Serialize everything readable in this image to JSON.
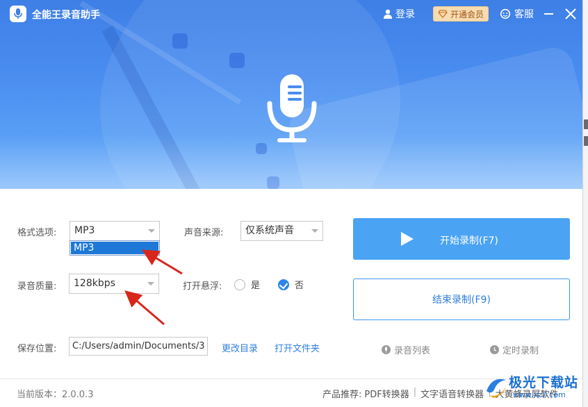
{
  "app": {
    "title": "全能王录音助手"
  },
  "header": {
    "login_label": "登录",
    "vip_label": "开通会员",
    "service_label": "客服"
  },
  "form": {
    "format_label": "格式选项:",
    "format_value": "MP3",
    "format_dropdown_option": "MP3",
    "source_label": "声音来源:",
    "source_value": "仅系统声音",
    "quality_label": "录音质量:",
    "quality_value": "128kbps",
    "float_label": "打开悬浮:",
    "float_yes": "是",
    "float_no": "否",
    "float_selected": "否",
    "save_label": "保存位置:",
    "save_path": "C:/Users/admin/Documents/3",
    "change_dir_label": "更改目录",
    "open_folder_label": "打开文件夹"
  },
  "actions": {
    "start_label": "开始录制(F7)",
    "stop_label": "结束录制(F9)",
    "record_list_label": "录音列表",
    "timer_label": "定时录制"
  },
  "footer": {
    "version_text": "当前版本：2.0.0.3",
    "products_label": "产品推荐:",
    "products": [
      "PDF转换器",
      "文字语音转换器",
      "大黄蜂录屏软件"
    ]
  },
  "watermark": {
    "brand": "极光下载站",
    "url": "www.xz7.com"
  },
  "colors": {
    "primary": "#4ba3f4",
    "link": "#2f7fe0",
    "vip_bg": "#f7dcb1",
    "selected": "#1e78d7",
    "annotation": "#d9261c"
  }
}
